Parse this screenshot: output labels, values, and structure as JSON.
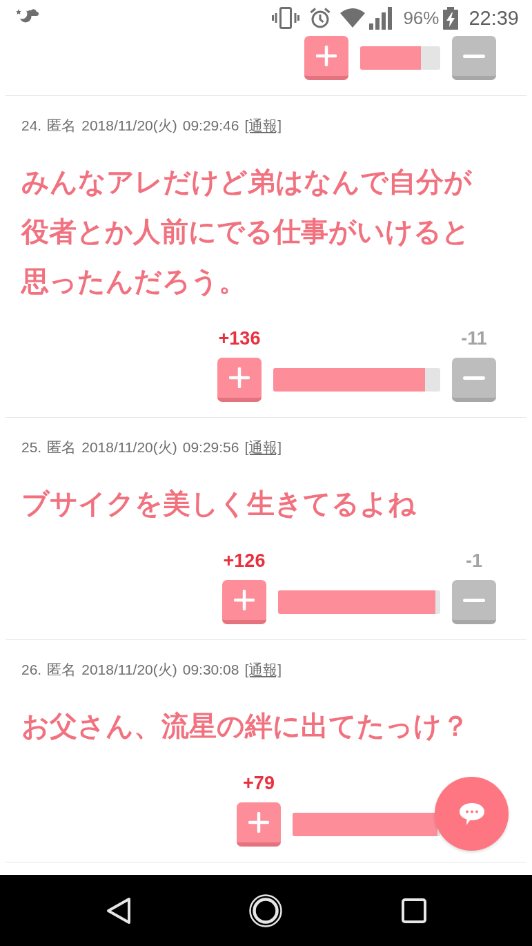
{
  "status_bar": {
    "battery_percent": "96%",
    "time": "22:39"
  },
  "posts": [
    {
      "kind": "votes_only",
      "votes": {
        "level": 0.76,
        "minus_button": true
      }
    },
    {
      "kind": "comment",
      "number": "24.",
      "author": "匿名",
      "date": "2018/11/20(火)",
      "time": "09:29:46",
      "report_link": "[通報]",
      "body": "みんなアレだけど弟はなんで自分が役者とか人前にでる仕事がいけると思ったんだろう。",
      "votes": {
        "plus": "+136",
        "minus": "-11",
        "level": 0.91,
        "minus_button": true
      }
    },
    {
      "kind": "comment",
      "number": "25.",
      "author": "匿名",
      "date": "2018/11/20(火)",
      "time": "09:29:56",
      "report_link": "[通報]",
      "body": "ブサイクを美しく生きてるよね",
      "votes": {
        "plus": "+126",
        "minus": "-1",
        "level": 0.97,
        "minus_button": true
      }
    },
    {
      "kind": "comment",
      "number": "26.",
      "author": "匿名",
      "date": "2018/11/20(火)",
      "time": "09:30:08",
      "report_link": "[通報]",
      "body": "お父さん、流星の絆に出てたっけ？",
      "votes": {
        "plus": "+79",
        "level": 0.98,
        "minus_button": false
      }
    }
  ]
}
